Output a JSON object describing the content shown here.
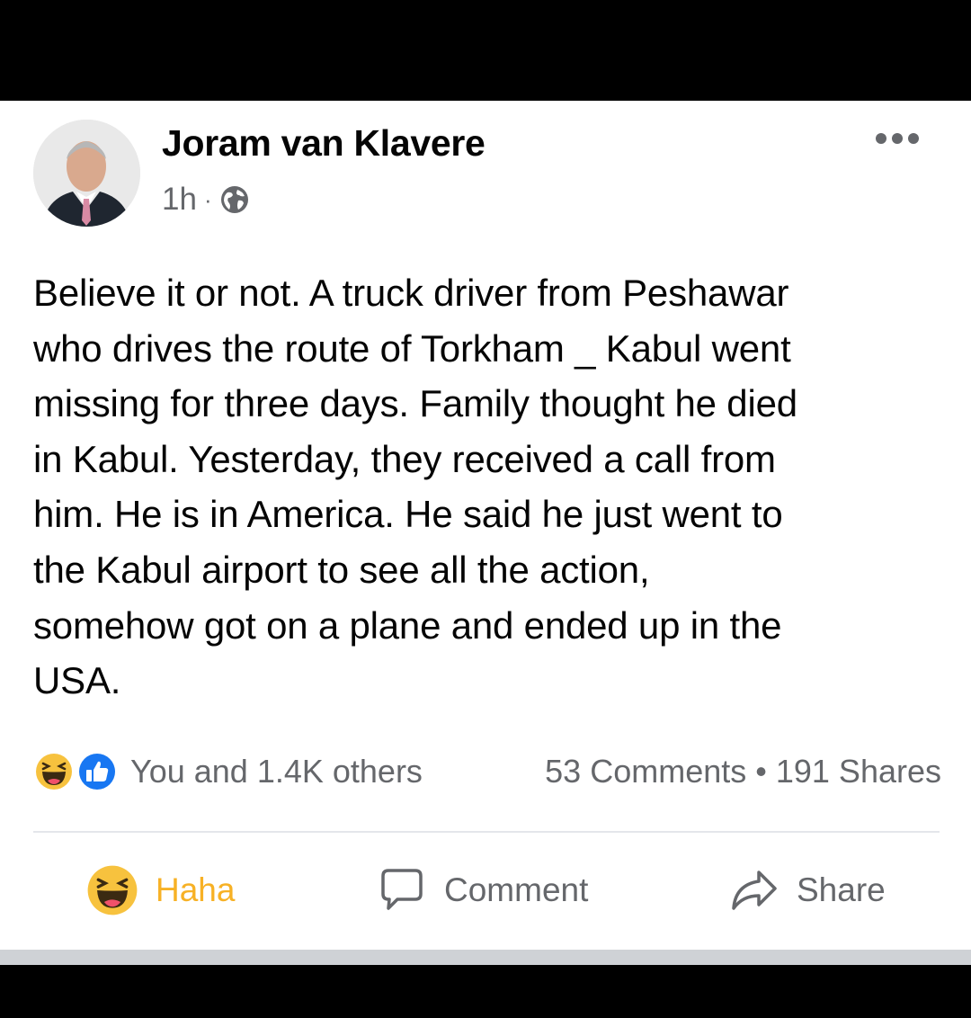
{
  "post": {
    "author": "Joram van Klavere",
    "time": "1h",
    "separator": "·",
    "privacy_icon": "globe-icon",
    "text": "Believe it or not. A truck driver from Peshawar\nwho drives the route of Torkham _ Kabul went\nmissing for three days. Family thought he died\nin Kabul.  Yesterday, they received a call from\nhim. He is in America.  He said he just went to\nthe Kabul airport to see all the action,\nsomehow got on a plane and ended up in the\nUSA."
  },
  "reactions": {
    "icons": [
      "haha-reaction-icon",
      "like-reaction-icon"
    ],
    "summary": "You and 1.4K others",
    "comments": "53 Comments",
    "dot": "•",
    "shares": "191 Shares"
  },
  "actions": {
    "haha_label": "Haha",
    "comment_label": "Comment",
    "share_label": "Share"
  },
  "colors": {
    "haha_active": "#f7b125",
    "secondary_text": "#65676b",
    "like_blue": "#1877f2"
  }
}
